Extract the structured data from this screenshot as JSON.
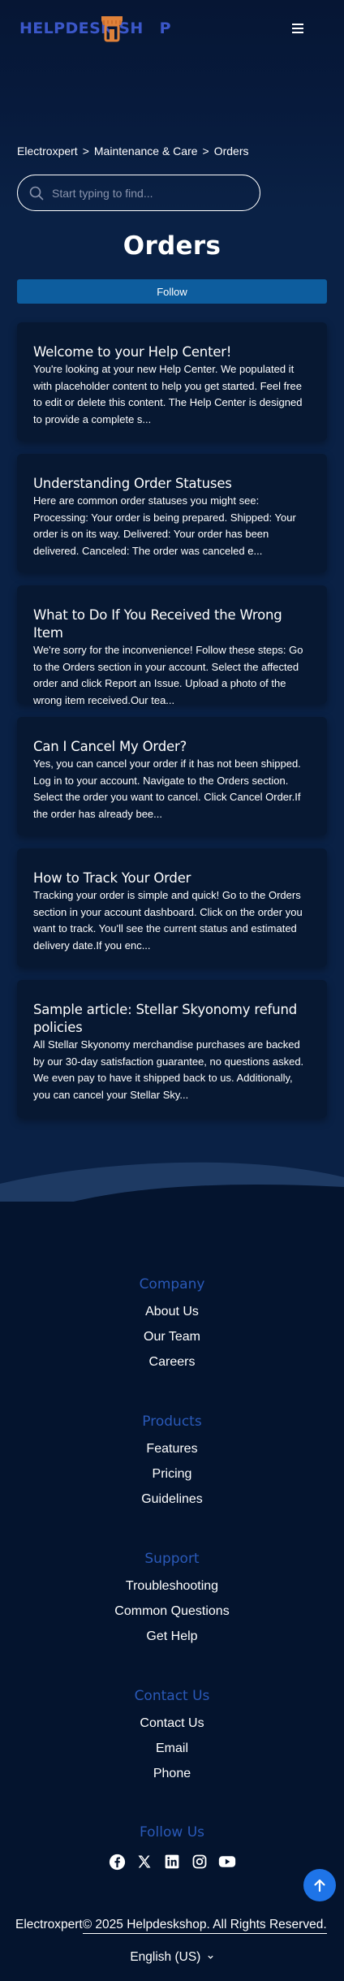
{
  "header": {
    "logo_text_before": "HELPDESK SH",
    "logo_text_after": "P",
    "menu_icon": "hamburger-menu-icon"
  },
  "breadcrumb": {
    "items": [
      "Electroxpert",
      "Maintenance & Care",
      "Orders"
    ],
    "separator": ">"
  },
  "search": {
    "placeholder": "Start typing to find...",
    "value": ""
  },
  "page": {
    "title": "Orders",
    "follow_label": "Follow"
  },
  "articles": [
    {
      "title": "Welcome to your Help Center!",
      "excerpt": "You're looking at your new Help Center. We populated it with placeholder content to help you get started. Feel free to edit or delete this content. The Help Center is designed to provide a complete s..."
    },
    {
      "title": "Understanding Order Statuses",
      "excerpt": "Here are common order statuses you might see: Processing: Your order is being prepared. Shipped: Your order is on its way. Delivered: Your order has been delivered. Canceled: The order was canceled e..."
    },
    {
      "title": "What to Do If You Received the Wrong Item",
      "excerpt": "We're sorry for the inconvenience! Follow these steps: Go to the Orders section in your account. Select the affected order and click Report an Issue. Upload a photo of the wrong item received.Our tea..."
    },
    {
      "title": "Can I Cancel My Order?",
      "excerpt": "Yes, you can cancel your order if it has not been shipped. Log in to your account. Navigate to the Orders section. Select the order you want to cancel. Click Cancel Order.If the order has already bee..."
    },
    {
      "title": "How to Track Your Order",
      "excerpt": "Tracking your order is simple and quick! Go to the Orders section in your account dashboard. Click on the order you want to track. You'll see the current status and estimated delivery date.If you enc..."
    },
    {
      "title": "Sample article: Stellar Skyonomy refund policies",
      "excerpt": "All Stellar Skyonomy merchandise purchases are backed by our 30-day satisfaction guarantee, no questions asked. We even pay to have it shipped back to us. Additionally, you can cancel your Stellar Sky..."
    }
  ],
  "footer": {
    "company": {
      "heading": "Company",
      "links": [
        "About Us",
        "Our Team",
        "Careers"
      ]
    },
    "products": {
      "heading": "Products",
      "links": [
        "Features",
        "Pricing",
        "Guidelines"
      ]
    },
    "support": {
      "heading": "Support",
      "links": [
        "Troubleshooting",
        "Common Questions",
        "Get Help"
      ]
    },
    "contact": {
      "heading": "Contact Us",
      "links": [
        "Contact Us",
        "Email",
        "Phone"
      ]
    },
    "follow": {
      "heading": "Follow Us",
      "icons": [
        "facebook-icon",
        "x-twitter-icon",
        "linkedin-icon",
        "instagram-icon",
        "youtube-icon"
      ]
    },
    "copyright_prefix": "Electroxpert",
    "copyright_link": "© 2025 Helpdeskshop. All Rights Reserved.",
    "language": "English (US)"
  },
  "colors": {
    "background": "#04142e",
    "card": "#071832",
    "accent": "#0d5d9e",
    "footer_heading": "#2a59b8",
    "scroll_top": "#1e74e8",
    "logo": "#3b57c9",
    "logo_mark": "#e0823a"
  }
}
